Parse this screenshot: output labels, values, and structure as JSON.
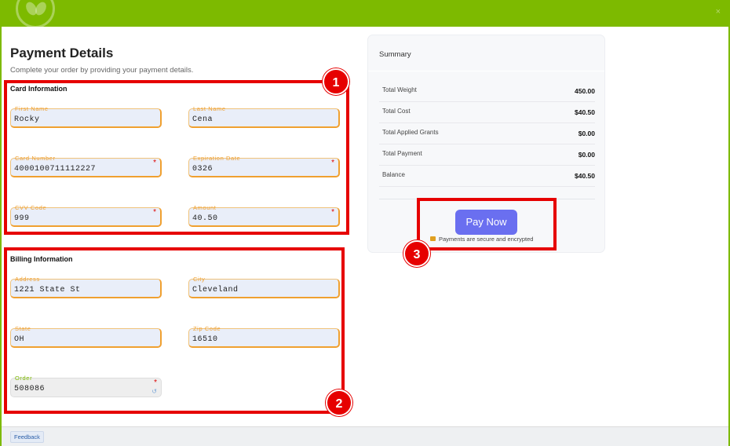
{
  "header": {
    "close_icon": "×"
  },
  "page": {
    "title": "Payment Details",
    "subtitle": "Complete your order by providing your payment details."
  },
  "card_info": {
    "title": "Card Information",
    "first_name": {
      "label": "First Name",
      "value": "Rocky"
    },
    "last_name": {
      "label": "Last Name",
      "value": "Cena"
    },
    "card_number": {
      "label": "Card Number",
      "value": "4000100711112227"
    },
    "expiration": {
      "label": "Expiration Date",
      "value": "0326"
    },
    "cvv": {
      "label": "CVV Code",
      "value": "999"
    },
    "amount": {
      "label": "Amount",
      "value": "40.50"
    }
  },
  "billing_info": {
    "title": "Billing Information",
    "address": {
      "label": "Address",
      "value": "1221 State St"
    },
    "city": {
      "label": "City",
      "value": "Cleveland"
    },
    "state": {
      "label": "State",
      "value": "OH"
    },
    "zip": {
      "label": "Zip Code",
      "value": "16510"
    },
    "order": {
      "label": "Order",
      "value": "508086"
    }
  },
  "summary": {
    "title": "Summary",
    "rows": [
      {
        "label": "Total Weight",
        "value": "450.00"
      },
      {
        "label": "Total Cost",
        "value": "$40.50"
      },
      {
        "label": "Total Applied Grants",
        "value": "$0.00"
      },
      {
        "label": "Total Payment",
        "value": "$0.00"
      },
      {
        "label": "Balance",
        "value": "$40.50"
      }
    ],
    "pay_label": "Pay Now",
    "secure_text": "Payments are secure and encrypted"
  },
  "badges": [
    "1",
    "2",
    "3"
  ],
  "required_mark": "*",
  "footer": {
    "feedback": "Feedback"
  },
  "colors": {
    "brand": "#7dba00",
    "highlight": "#e60000",
    "pay_button": "#6a6ff0",
    "field_accent": "#f0a030"
  },
  "icons": [
    "leaf-logo-icon",
    "close-icon",
    "required-icon",
    "refresh-icon",
    "lock-icon"
  ]
}
